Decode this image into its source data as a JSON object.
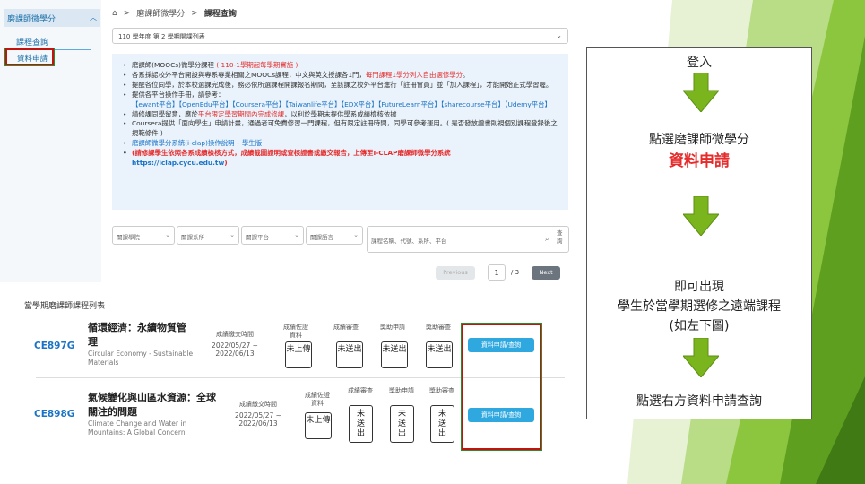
{
  "sidebar": {
    "header": "磨課師微學分",
    "items": [
      {
        "label": "課程查詢"
      },
      {
        "label": "資料申請"
      }
    ]
  },
  "breadcrumb": {
    "items": [
      "磨課師微學分",
      "課程查詢"
    ]
  },
  "semester_select": {
    "value": "110 學年度 第 2 學期開課列表"
  },
  "info": {
    "l1a": "磨課師(MOOCs)微學分課程 ",
    "l1b": "( 110-1學期起每學期實施 )",
    "l2a": "各系採認校外平台開設與專系專業相關之MOOCs課程，中文與英文授課各1門，",
    "l2b": "每門課程1學分列入自由選修學分",
    "l2c": "。",
    "l3": "提醒各位同學，於本校選課完成後，務必依所選課程開課報名期間，至該課之校外平台進行「註冊會員」並「加入課程」，才能開始正式學習喔。",
    "l4": "提供各平台操作手冊，請參考：",
    "l4links": "【ewant平台】【OpenEdu平台】【Coursera平台】【Taiwanlife平台】【EDX平台】【FutureLearn平台】【sharecourse平台】【Udemy平台】",
    "l5a": "請修課同學留意，應於",
    "l5b": "平台限定學習期間內完成修課",
    "l5c": "，以利於學期末提供學系成績檢核依據",
    "l6": "Coursera提供「面向學生」申請計畫，通過者可免費修習一門課程，但有限定註冊時間，同學可參考運用。( 是否發放證書則視個別課程登錄後之規範條件 )",
    "l7": "磨課師微學分系統(i-clap)操作說明 – 學生版",
    "l8a": "(請修課學生依照各系成績檢核方式，成績截圖證明或查核證書或繳交報告，上傳至I-CLAP磨課師微學分系統",
    "l8b": "https://iclap.cycu.edu.tw",
    "l8c": ")"
  },
  "filters": {
    "school": "開課學院",
    "dept": "開課系所",
    "platform": "開課平台",
    "language": "開課語言",
    "search_placeholder": "課程名稱、代號、系所、平台",
    "search_label": "查詢"
  },
  "pager": {
    "prev": "Previous",
    "page": "1",
    "total": "/ 3",
    "next": "Next"
  },
  "course_list": {
    "title": "當學期磨課師課程列表",
    "rows": [
      {
        "code": "CE897G",
        "name_zh": "循環經濟：永續物質管理",
        "name_en": "Circular Economy - Sustainable Materials",
        "period_label": "成績繳交時間",
        "period": "2022/05/27 ~ 2022/06/13",
        "h1": "成績佐證資料",
        "h2": "成績審查",
        "h3": "獎助申請",
        "h4": "獎助審查",
        "s1": "未上傳",
        "s2": "未送出",
        "s3": "未送出",
        "s4": "未送出",
        "action": "資料申請/查詢"
      },
      {
        "code": "CE898G",
        "name_zh": "氣候變化與山區水資源：全球關注的問題",
        "name_en": "Climate Change and Water in Mountains: A Global Concern",
        "period_label": "成績繳交時間",
        "period": "2022/05/27 ~ 2022/06/13",
        "h1": "成績佐證資料",
        "h2": "成績審查",
        "h3": "獎助申請",
        "h4": "獎助審查",
        "s1": "未上傳",
        "s2": "未送出",
        "s3": "未送出",
        "s4": "未送出",
        "action": "資料申請/查詢"
      }
    ]
  },
  "flow": {
    "step1": "登入",
    "step2a": "點選磨課師微學分",
    "step2b": "資料申請",
    "step3a": "即可出現",
    "step3b": "學生於當學期選修之遠端課程",
    "step3c": "(如左下圖)",
    "step4": "點選右方資料申請查詢"
  },
  "colors": {
    "accent_blue": "#1a73c7",
    "highlight_red": "#e52b2b",
    "arrow_green": "#7ab51d",
    "bg_green": "#8cc63f"
  }
}
